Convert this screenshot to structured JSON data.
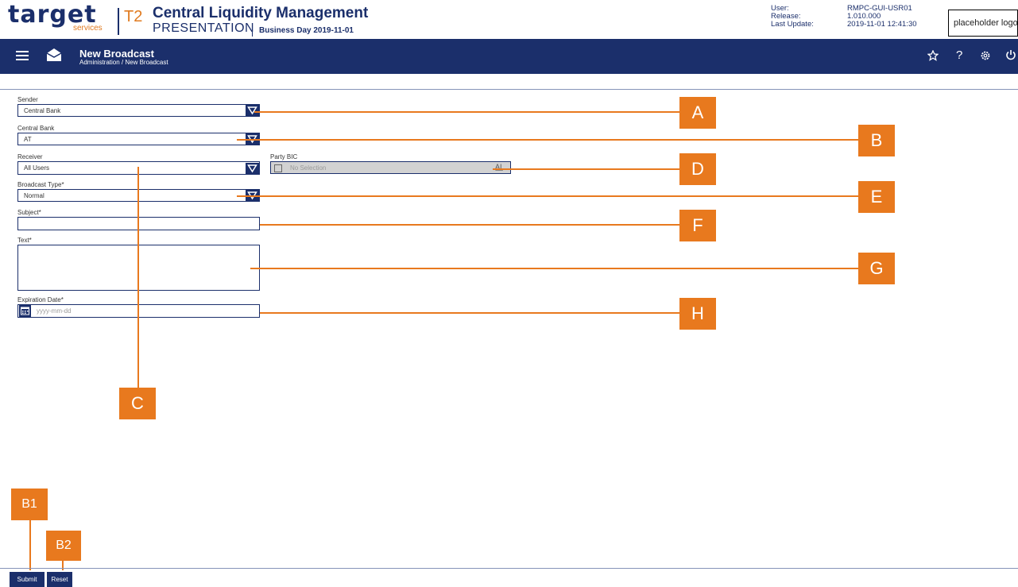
{
  "header": {
    "logo_word": "target",
    "logo_sub": "services",
    "t2": "T2",
    "app_title": "Central Liquidity Management",
    "environment": "PRESENTATION",
    "business_day": "Business Day 2019-11-01",
    "user_label": "User:",
    "release_label": "Release:",
    "last_update_label": "Last Update:",
    "user_value": "RMPC-GUI-USR01",
    "release_value": "1.010.000",
    "last_update_value": "2019-11-01 12:41:30",
    "placeholder_logo": "placeholder logo"
  },
  "navbar": {
    "title": "New Broadcast",
    "breadcrumb": "Administration  /  New Broadcast",
    "icons": [
      "menu-icon",
      "mail-icon",
      "star-icon",
      "help-icon",
      "settings-icon",
      "power-icon"
    ]
  },
  "form": {
    "sender_label": "Sender",
    "sender_value": "Central Bank",
    "central_bank_label": "Central Bank",
    "central_bank_value": "AT",
    "receiver_label": "Receiver",
    "receiver_value": "All Users",
    "party_bic_label": "Party BIC",
    "party_bic_value": "No Selection",
    "broadcast_type_label": "Broadcast Type*",
    "broadcast_type_value": "Normal",
    "subject_label": "Subject*",
    "subject_value": "",
    "text_label": "Text*",
    "text_value": "",
    "expiration_label": "Expiration Date*",
    "expiration_placeholder": "yyyy-mm-dd"
  },
  "callouts": {
    "A": "A",
    "B": "B",
    "C": "C",
    "D": "D",
    "E": "E",
    "F": "F",
    "G": "G",
    "H": "H",
    "B1": "B1",
    "B2": "B2"
  },
  "footer": {
    "submit_label": "Submit",
    "reset_label": "Reset"
  },
  "colors": {
    "navy": "#1b2f6b",
    "orange": "#e8791e",
    "disabled_grey": "#d2d2d2"
  }
}
